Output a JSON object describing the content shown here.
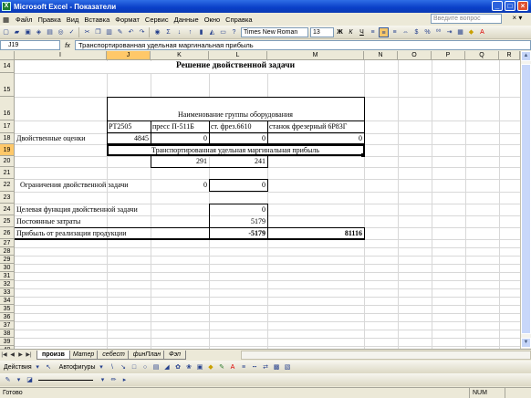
{
  "window": {
    "title": "Microsoft Excel - Показатели",
    "app_icon": "excel-icon"
  },
  "menu": {
    "items": [
      "Файл",
      "Правка",
      "Вид",
      "Вставка",
      "Формат",
      "Сервис",
      "Данные",
      "Окно",
      "Справка"
    ],
    "help_placeholder": "Введите вопрос"
  },
  "toolbar": {
    "font": "Times New Roman",
    "size": "13",
    "bold": "Ж",
    "italic": "К",
    "underline": "Ч",
    "percent": "%",
    "zoom_sigma": "Σ"
  },
  "formula_bar": {
    "cell": "J19",
    "fx": "fx",
    "content": "Транспортированная удельная маргинальная прибыль"
  },
  "columns": [
    "I",
    "J",
    "K",
    "L",
    "M",
    "N",
    "O",
    "P",
    "Q",
    "R"
  ],
  "selected_column": "J",
  "selected_row": "19",
  "rows": [
    "14",
    "15",
    "16",
    "17",
    "18",
    "19",
    "20",
    "21",
    "22",
    "23",
    "24",
    "25",
    "26",
    "27",
    "28",
    "29",
    "30",
    "31",
    "32",
    "33",
    "34",
    "35",
    "36",
    "37",
    "38",
    "39",
    "40"
  ],
  "cells": {
    "title": "Решение двойственной задачи",
    "group_header": "Наименование группы оборудования",
    "equip": [
      "PT2505",
      "пресс П-511Б",
      "ст. фрез.6610",
      "станок фрезерный 6Р83Г"
    ],
    "dual_label": "Двойственные оценки",
    "dual_values": [
      "4845",
      "0",
      "0",
      "0"
    ],
    "margin_label": "Транспортированная удельная маргинальная прибыль",
    "margin_values": [
      "291",
      "241"
    ],
    "constraints_label": "Ограничения двойственной задачи",
    "constraints_values": [
      "0",
      "0"
    ],
    "objective_label": "Целевая функция двойственной задачи",
    "objective_value": "0",
    "fixed_label": "Постоянные затраты",
    "fixed_value": "5179",
    "profit_label": "Прибыль от реализации продукции",
    "profit_value": "-5179",
    "profit_total": "81116"
  },
  "sheet_tabs": [
    "произв",
    "Матер",
    "себест",
    "финПлан",
    "Фэп"
  ],
  "active_tab": "произв",
  "drawing": {
    "actions": "Действия",
    "autoshapes": "Автофигуры"
  },
  "status": {
    "text": "Готово",
    "num": "NUM"
  }
}
